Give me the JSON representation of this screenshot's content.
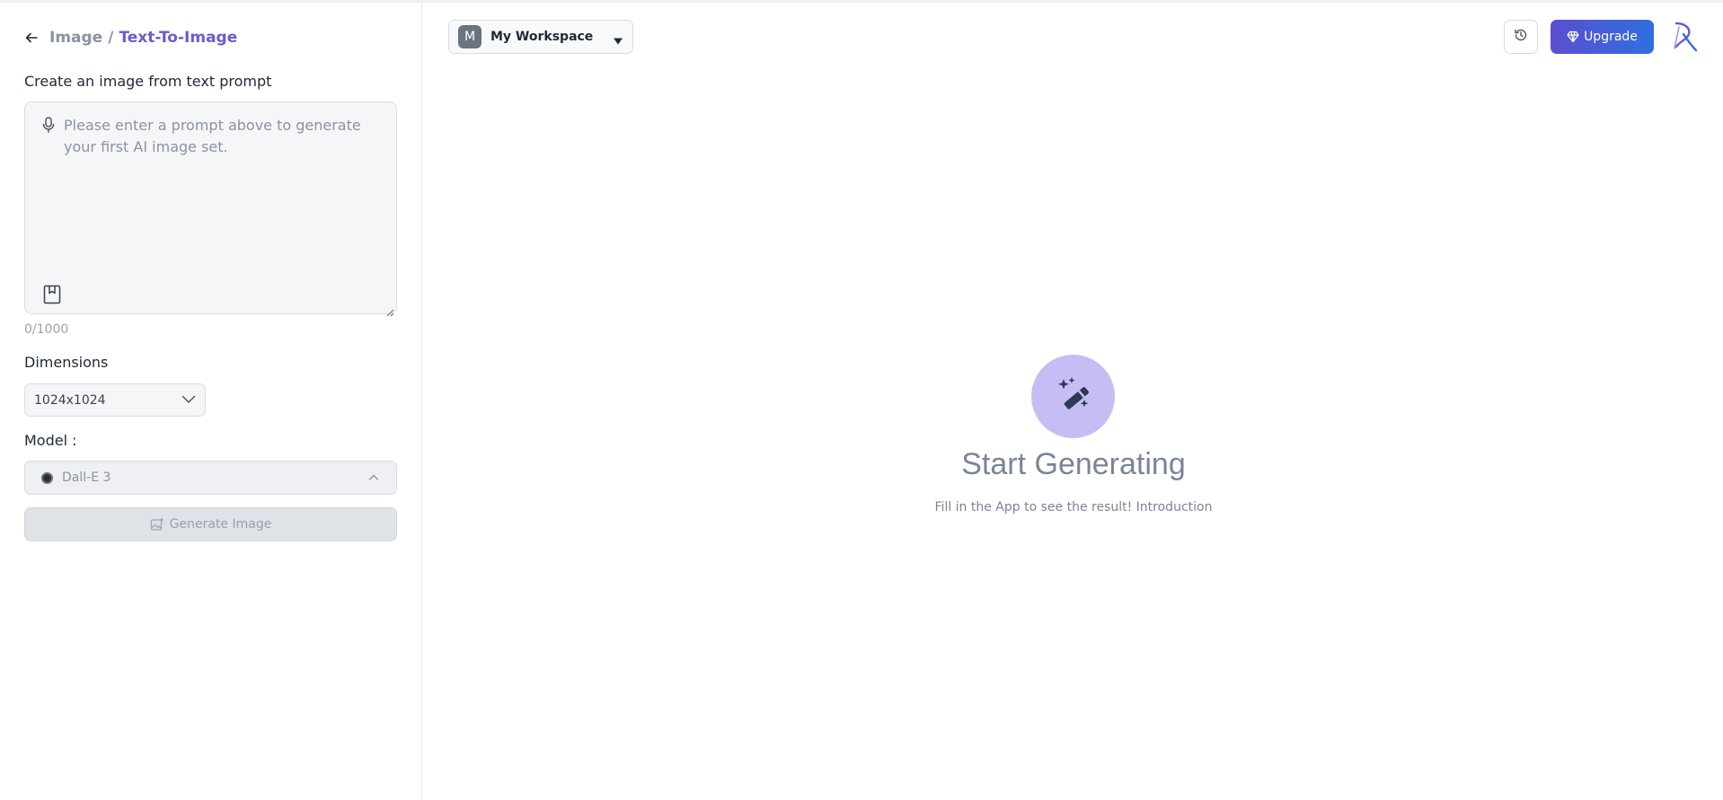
{
  "breadcrumb": {
    "parent": "Image",
    "separator": "/",
    "current": "Text-To-Image"
  },
  "prompt": {
    "section_label": "Create an image from text prompt",
    "placeholder": "Please enter a prompt above to generate your first AI image set.",
    "counter": "0/1000"
  },
  "dimensions": {
    "label": "Dimensions",
    "selected": "1024x1024"
  },
  "model": {
    "label": "Model :",
    "selected": "Dall-E 3"
  },
  "generate_button": {
    "label": "Generate Image",
    "disabled": true
  },
  "workspace": {
    "avatar_letter": "M",
    "name": "My Workspace"
  },
  "header": {
    "upgrade_label": "Upgrade"
  },
  "empty_state": {
    "title": "Start Generating",
    "subtitle": "Fill in the App to see the result! Introduction"
  },
  "colors": {
    "accent": "#6d5acf",
    "upgrade_gradient_start": "#5a4fcf",
    "upgrade_gradient_end": "#2f6fe0",
    "magic_circle": "#c7bdf5"
  },
  "icons": [
    "arrow-left-icon",
    "microphone-icon",
    "bookmark-icon",
    "chevron-down-icon",
    "chevron-up-icon",
    "image-generate-icon",
    "caret-down-icon",
    "history-icon",
    "gem-icon",
    "logo-icon",
    "magic-wand-icon"
  ]
}
